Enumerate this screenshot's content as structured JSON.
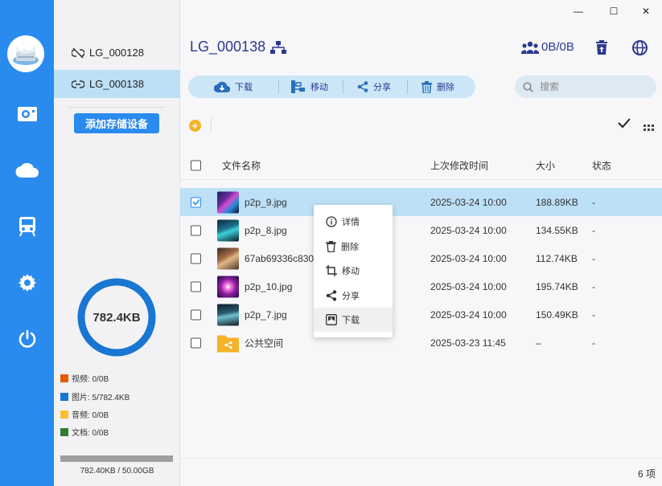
{
  "window": {
    "minimize": "—",
    "maximize": "☐",
    "close": "✕"
  },
  "devices": [
    {
      "name": "LG_000128",
      "status": "disconnected"
    },
    {
      "name": "LG_000138",
      "status": "connected",
      "active": true
    }
  ],
  "add_device_label": "添加存储设备",
  "storage": {
    "total_used": "782.4KB",
    "legend": [
      {
        "label": "视频: 0/0B",
        "color": "#e65c00"
      },
      {
        "label": "图片: 5/782.4KB",
        "color": "#1976d2"
      },
      {
        "label": "音频: 0/0B",
        "color": "#fbc02d"
      },
      {
        "label": "文档: 0/0B",
        "color": "#2e7d32"
      }
    ],
    "capacity_text": "782.40KB / 50.00GB",
    "ring_color": "#1976d2"
  },
  "header": {
    "device_title": "LG_000138",
    "quota": "0B/0B"
  },
  "toolbar": {
    "download": "下载",
    "move": "移动",
    "share": "分享",
    "delete": "删除"
  },
  "search": {
    "placeholder": "搜索",
    "value": ""
  },
  "table": {
    "columns": {
      "checkbox": "",
      "name": "文件名称",
      "modified": "上次修改时间",
      "size": "大小",
      "status": "状态"
    },
    "rows": [
      {
        "name": "p2p_9.jpg",
        "modified": "2025-03-24 10:00",
        "size": "188.89KB",
        "status": "-",
        "selected": true
      },
      {
        "name": "p2p_8.jpg",
        "modified": "2025-03-24 10:00",
        "size": "134.55KB",
        "status": "-"
      },
      {
        "name": "67ab69336c830",
        "modified": "2025-03-24 10:00",
        "size": "112.74KB",
        "status": "-"
      },
      {
        "name": "p2p_10.jpg",
        "modified": "2025-03-24 10:00",
        "size": "195.74KB",
        "status": "-"
      },
      {
        "name": "p2p_7.jpg",
        "modified": "2025-03-24 10:00",
        "size": "150.49KB",
        "status": "-"
      },
      {
        "name": "公共空间",
        "modified": "2025-03-23 11:45",
        "size": "–",
        "status": "-"
      }
    ]
  },
  "context_menu": {
    "details": "详情",
    "delete": "删除",
    "move": "移动",
    "share": "分享",
    "download": "下载"
  },
  "footer": {
    "count": "6 项"
  },
  "colors": {
    "accent": "#2a8bef",
    "title": "#2b3990",
    "selected_row": "#bde0f7",
    "folder": "#f5b32a"
  }
}
